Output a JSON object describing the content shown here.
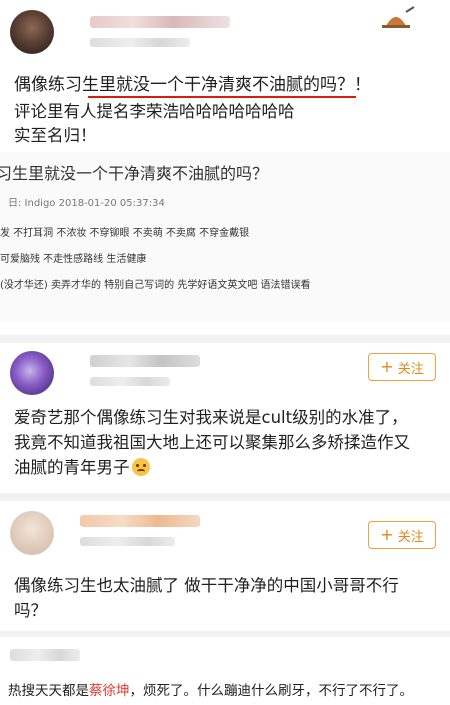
{
  "post1": {
    "text_lines": [
      "偶像练习生里就没一个干净清爽不油腻的吗？！",
      "评论里有人提名李荣浩哈哈哈哈哈哈哈",
      "实至名归！"
    ],
    "embedded_screenshot": {
      "title_line": "习生里就没一个干净清爽不油腻的吗？",
      "meta": "日: Indigo   2018-01-20 05:37:34",
      "tag_lines": [
        "发 不打耳洞 不浓妆 不穿铆眼 不卖萌 不卖腐 不穿金戴银",
        "可爱脑残 不走性感路线 生活健康",
        "(没才华还)  卖弄才华的  特别自己写词的  先学好语文英文吧  语法错误看"
      ]
    }
  },
  "post2": {
    "follow_label": "关注",
    "text_lines": [
      "爱奇艺那个偶像练习生对我来说是cult级别的水准了，",
      "我竟不知道我祖国大地上还可以聚集那么多矫揉造作又",
      "油腻的青年男子"
    ]
  },
  "post3": {
    "follow_label": "关注",
    "text_lines": [
      "偶像练习生也太油腻了 做干干净净的中国小哥哥不行",
      "吗？"
    ]
  },
  "caption": {
    "prefix": "热搜天天都是",
    "highlight": "蔡徐坤",
    "suffix": "，烦死了。什么蹦迪什么刷牙，不行了不行了。"
  },
  "colors": {
    "accent_orange": "#e08a1a",
    "underline_red": "#d81e06",
    "highlight_red": "#e3392f"
  }
}
